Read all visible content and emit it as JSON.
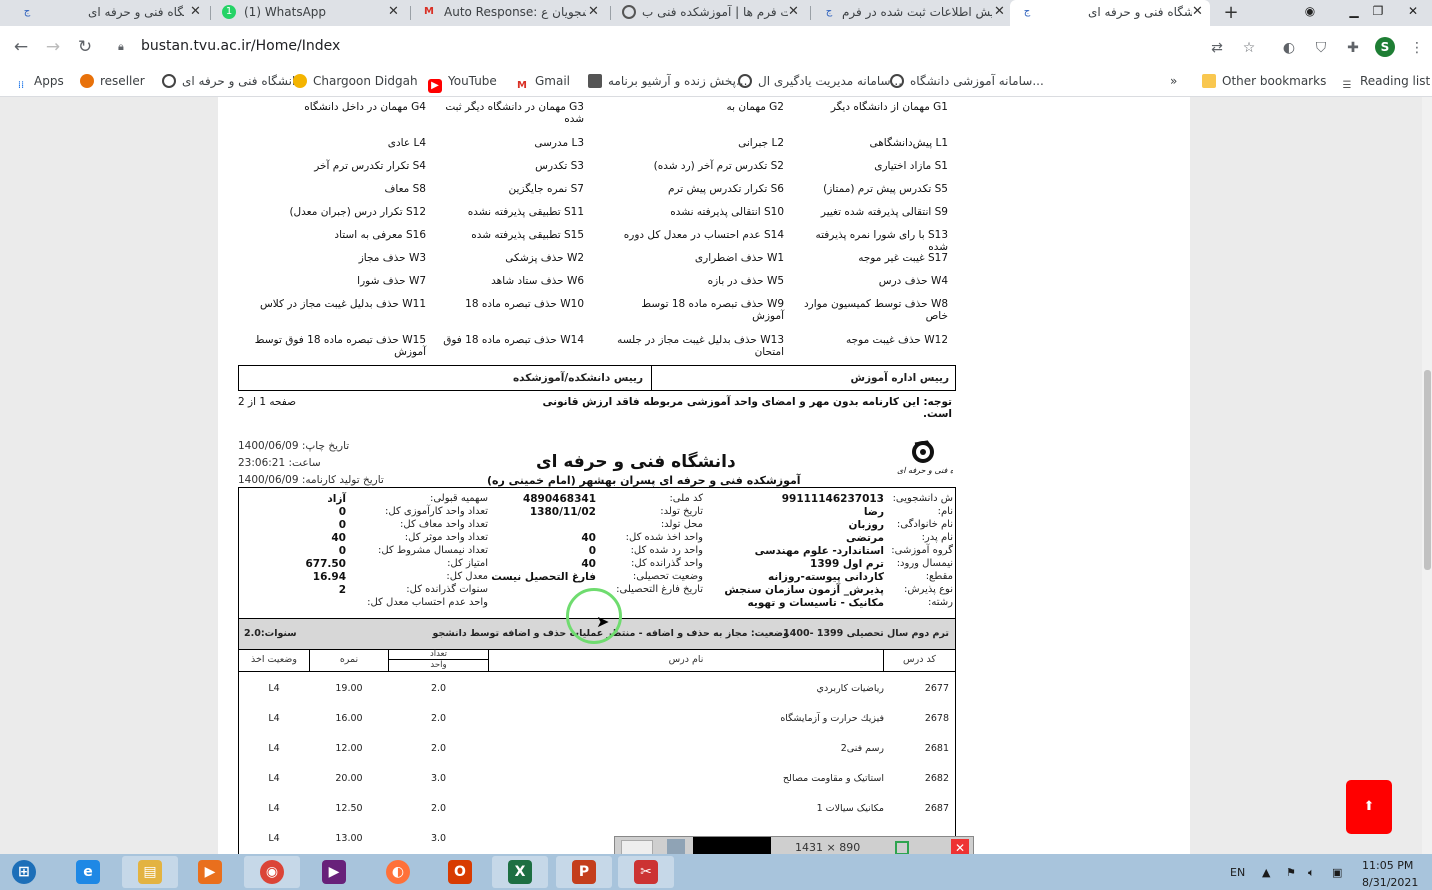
{
  "browser": {
    "tabs": [
      {
        "title": "دانشگاه فنی و حرفه ای",
        "active": false
      },
      {
        "title": "(1) WhatsApp",
        "active": false
      },
      {
        "title": "Auto Response: دانشجویان ع",
        "active": false
      },
      {
        "title": "فهرست فرم ها | آموزشکده فنی ب",
        "active": false
      },
      {
        "title": "نمایش اطلاعات ثبت شده در فرم",
        "active": false
      },
      {
        "title": "دانشگاه فنی و حرفه ای",
        "active": true
      }
    ],
    "new_tab": "+",
    "url": "bustan.tvu.ac.ir/Home/Index",
    "profile_initial": "S",
    "bookmarks": [
      {
        "label": "Apps"
      },
      {
        "label": "reseller"
      },
      {
        "label": "دانشگاه فنی و حرفه ای"
      },
      {
        "label": "Chargoon Didgah"
      },
      {
        "label": "YouTube"
      },
      {
        "label": "Gmail"
      },
      {
        "label": "پخش زنده و آرشیو برنامه..."
      },
      {
        "label": "سامانه مدیریت یادگیری ال..."
      },
      {
        "label": "سامانه آموزشی دانشگاه..."
      }
    ],
    "bookmarks_more": "»",
    "other_bookmarks": "Other bookmarks",
    "reading_list": "Reading list"
  },
  "legend": {
    "rows": [
      [
        "G1 مهمان از دانشگاه دیگر",
        "G2 مهمان به",
        "G3 مهمان در دانشگاه دیگر ثبت شده",
        "G4 مهمان در داخل دانشگاه"
      ],
      [
        "L1 پیش‌دانشگاهی",
        "L2 جبرانی",
        "L3 مدرسی",
        "L4 عادی"
      ],
      [
        "S1 مازاد اختیاری",
        "S2 تکدرس ترم آخر (رد شده)",
        "S3 تکدرس",
        "S4 تکرار تکدرس ترم آخر"
      ],
      [
        "S5 تکدرس پیش ترم (ممتاز)",
        "S6 تکرار تکدرس پیش ترم",
        "S7 نمره جایگزین",
        "S8 معاف"
      ],
      [
        "S9 انتقالی پذیرفته شده تغییر",
        "S10 انتقالی پذیرفته نشده",
        "S11 تطبیقی پذیرفته نشده",
        "S12 تکرار درس (جبران معدل)"
      ],
      [
        "S13 با رای شورا نمره پذیرفته شده",
        "S14 عدم احتساب در معدل کل دوره",
        "S15 تطبیقی پذیرفته شده",
        "S16 معرفی به استاد"
      ],
      [
        "S17 غیبت غیر موجه",
        "W1 حذف اضطراری",
        "W2 حذف پزشکی",
        "W3 حذف مجاز"
      ],
      [
        "W4 حذف درس",
        "W5 حذف در بازه",
        "W6 حذف ستاد شاهد",
        "W7 حذف شورا"
      ],
      [
        "W8 حذف توسط کمیسیون موارد خاص",
        "W9 حذف تبصره ماده 18 توسط آموزش",
        "W10 حذف تبصره ماده 18",
        "W11 حذف بدلیل غیبت مجاز در کلاس"
      ],
      [
        "W12 حذف غیبت موجه",
        "W13 حذف بدلیل غیبت مجاز در جلسه امتحان",
        "W14 حذف تبصره ماده 18 فوق",
        "W15 حذف تبصره ماده 18 فوق توسط آموزش"
      ]
    ]
  },
  "signatures": {
    "left": "رییس اداره آموزش",
    "right": "رییس دانشکده/آموزشکده"
  },
  "notice": "توجه: این کارنامه بدون مهر و امضای واحد آموزشی مربوطه فاقد ارزش قانونی است.",
  "page_num": "صفحه 1 از 2",
  "header": {
    "print_date": "تاریخ چاپ: 1400/06/09",
    "time": "ساعت: 23:06:21",
    "gen_date": "تاریخ تولید کارنامه: 1400/06/09",
    "university": "دانشگاه فنی و حرفه ای",
    "college": "آموزشکده فنی و حرفه ای پسران بهشهر (امام خمینی ره)",
    "logo_caption": "دانشگاه فنی و حرفه ای"
  },
  "student": {
    "col1": [
      {
        "label": "ش دانشجویی:",
        "value": "99111146237013"
      },
      {
        "label": "نام:",
        "value": "رضا"
      },
      {
        "label": "نام خانوادگی:",
        "value": "روزبان"
      },
      {
        "label": "نام پدر:",
        "value": "مرتضی"
      },
      {
        "label": "گروه آموزشی:",
        "value": "استاندارد- علوم مهندسی"
      },
      {
        "label": "نیمسال ورود:",
        "value": "ترم اول 1399"
      },
      {
        "label": "مقطع:",
        "value": "کاردانی پیوسته-روزانه"
      },
      {
        "label": "نوع پذیرش:",
        "value": "پذیرش_ آزمون سازمان سنجش"
      },
      {
        "label": "رشته:",
        "value": "مکانیک - تاسیسات و تهویه"
      }
    ],
    "col2": [
      {
        "label": "کد ملی:",
        "value": "4890468341"
      },
      {
        "label": "تاریخ تولد:",
        "value": "1380/11/02"
      },
      {
        "label": "محل تولد:",
        "value": ""
      },
      {
        "label": "واحد اخذ شده کل:",
        "value": "40"
      },
      {
        "label": "واحد رد شده کل:",
        "value": "0"
      },
      {
        "label": "واحد گذرانده کل:",
        "value": "40"
      },
      {
        "label": "وضعیت تحصیلی:",
        "value": "فارغ التحصیل نیست"
      },
      {
        "label": "تاریخ فارغ التحصیلی:",
        "value": ""
      }
    ],
    "col3": [
      {
        "label": "سهمیه قبولی:",
        "value": "آزاد"
      },
      {
        "label": "تعداد واحد کارآموزی کل:",
        "value": "0"
      },
      {
        "label": "تعداد واحد معاف کل:",
        "value": "0"
      },
      {
        "label": "تعداد واحد موثر کل:",
        "value": "40"
      },
      {
        "label": "تعداد نیمسال مشروط کل:",
        "value": "0"
      },
      {
        "label": "امتیاز کل:",
        "value": "677.50"
      },
      {
        "label": "معدل کل:",
        "value": "16.94"
      },
      {
        "label": "سنوات گذرانده کل:",
        "value": "2"
      },
      {
        "label": "واحد عدم احتساب معدل کل:",
        "value": ""
      }
    ]
  },
  "term": {
    "title": "ترم دوم سال تحصیلی 1399 -1400",
    "status": "وضعیت: مجاز به حذف و اضافه - منتظر عملیات حذف و اضافه توسط دانشجو",
    "years": "سنوات:2.0"
  },
  "grade_table": {
    "headers": {
      "code": "کد درس",
      "name": "نام درس",
      "units": "تعداد واحد",
      "units_top": "تعداد",
      "units_bottom": "واحد",
      "grade": "نمره",
      "status": "وضعیت اخذ"
    },
    "rows": [
      {
        "code": "2677",
        "name": "رياضيات كاربردي",
        "units": "2.0",
        "grade": "19.00",
        "status": "L4"
      },
      {
        "code": "2678",
        "name": "فيزيك حرارت و آزمايشگاه",
        "units": "2.0",
        "grade": "16.00",
        "status": "L4"
      },
      {
        "code": "2681",
        "name": "رسم فنی2",
        "units": "2.0",
        "grade": "12.00",
        "status": "L4"
      },
      {
        "code": "2682",
        "name": "استاتیک و مقاومت مصالح",
        "units": "3.0",
        "grade": "20.00",
        "status": "L4"
      },
      {
        "code": "2687",
        "name": "مکانیک سیالات 1",
        "units": "2.0",
        "grade": "12.50",
        "status": "L4"
      },
      {
        "code": "",
        "name": "",
        "units": "3.0",
        "grade": "13.00",
        "status": "L4"
      }
    ]
  },
  "overlay": {
    "resolution": "1431 × 890"
  },
  "scroll_top_button": "⬆",
  "taskbar": {
    "apps": [
      "start-button",
      "ie",
      "explorer",
      "media",
      "chrome",
      "vs",
      "firefox",
      "office",
      "excel",
      "powerpoint",
      "snipping"
    ],
    "lang": "EN",
    "time": "11:05 PM",
    "date": "8/31/2021"
  }
}
